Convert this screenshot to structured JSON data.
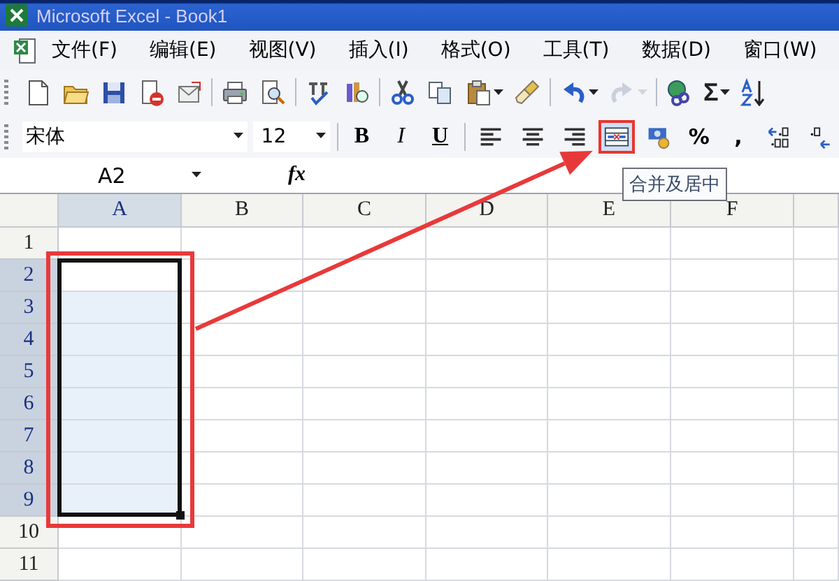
{
  "window": {
    "title": "Microsoft Excel - Book1"
  },
  "menu": [
    {
      "label": "文件(F)"
    },
    {
      "label": "编辑(E)"
    },
    {
      "label": "视图(V)"
    },
    {
      "label": "插入(I)"
    },
    {
      "label": "格式(O)"
    },
    {
      "label": "工具(T)"
    },
    {
      "label": "数据(D)"
    },
    {
      "label": "窗口(W)"
    }
  ],
  "standard_toolbar": [
    {
      "kind": "new",
      "disabled": false
    },
    {
      "kind": "open",
      "disabled": false
    },
    {
      "kind": "save",
      "disabled": false
    },
    {
      "kind": "permission",
      "disabled": false
    },
    {
      "kind": "mail",
      "disabled": false
    },
    {
      "kind": "print",
      "disabled": false
    },
    {
      "kind": "preview",
      "disabled": false
    },
    {
      "kind": "spelling",
      "disabled": false
    },
    {
      "kind": "research",
      "disabled": false
    },
    {
      "kind": "cut",
      "disabled": false
    },
    {
      "kind": "copy",
      "disabled": false
    },
    {
      "kind": "paste",
      "disabled": false
    },
    {
      "kind": "painter",
      "disabled": false
    },
    {
      "kind": "undo",
      "disabled": false
    },
    {
      "kind": "redo",
      "disabled": true
    },
    {
      "kind": "link",
      "disabled": false
    },
    {
      "kind": "sum",
      "label": "Σ",
      "disabled": false
    },
    {
      "kind": "sort",
      "disabled": false
    }
  ],
  "formatting_toolbar": {
    "font": "宋体",
    "size": "12",
    "buttons": [
      {
        "kind": "bold",
        "label": "B",
        "highlighted": false
      },
      {
        "kind": "italic",
        "label": "I",
        "highlighted": false
      },
      {
        "kind": "underline",
        "label": "U",
        "highlighted": false
      },
      {
        "kind": "align-left",
        "highlighted": false
      },
      {
        "kind": "center",
        "highlighted": false
      },
      {
        "kind": "align-right",
        "highlighted": false
      },
      {
        "kind": "merge",
        "highlighted": true
      },
      {
        "kind": "currency",
        "highlighted": false
      },
      {
        "kind": "percent",
        "label": "%",
        "highlighted": false
      },
      {
        "kind": "comma",
        "label": ",",
        "highlighted": false
      },
      {
        "kind": "increase-decimal",
        "highlighted": false
      },
      {
        "kind": "decrease-decimal",
        "highlighted": false
      }
    ]
  },
  "formula_bar": {
    "name_box": "A2",
    "function_label": "fx"
  },
  "tooltip": {
    "text": "合并及居中"
  },
  "sheet": {
    "columns": [
      {
        "label": "A",
        "selected": true
      },
      {
        "label": "B",
        "selected": false
      },
      {
        "label": "C",
        "selected": false
      },
      {
        "label": "D",
        "selected": false
      },
      {
        "label": "E",
        "selected": false
      },
      {
        "label": "F",
        "selected": false
      }
    ],
    "rows": [
      {
        "label": "1",
        "selected": false,
        "active": false
      },
      {
        "label": "2",
        "selected": true,
        "active": true
      },
      {
        "label": "3",
        "selected": true,
        "active": false
      },
      {
        "label": "4",
        "selected": true,
        "active": false
      },
      {
        "label": "5",
        "selected": true,
        "active": false
      },
      {
        "label": "6",
        "selected": true,
        "active": false
      },
      {
        "label": "7",
        "selected": true,
        "active": false
      },
      {
        "label": "8",
        "selected": true,
        "active": false
      },
      {
        "label": "9",
        "selected": true,
        "active": false
      },
      {
        "label": "10",
        "selected": false,
        "active": false
      },
      {
        "label": "11",
        "selected": false,
        "active": false
      }
    ]
  }
}
